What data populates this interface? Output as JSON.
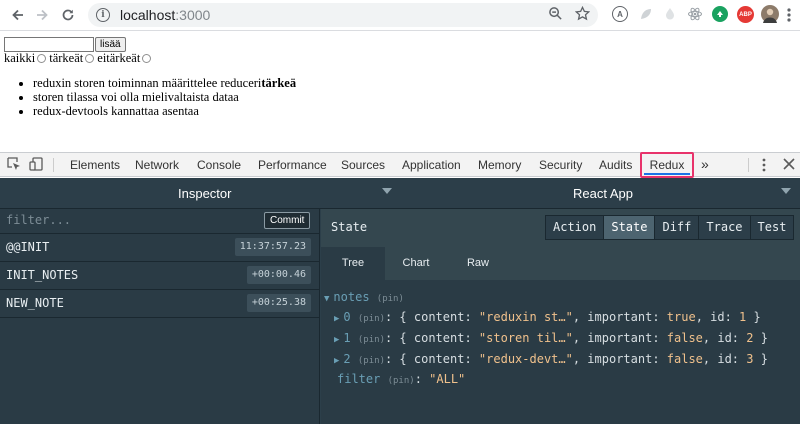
{
  "browser": {
    "url_host": "localhost",
    "url_port": ":3000",
    "extensions": [
      "A",
      "ABP"
    ]
  },
  "page": {
    "add_button": "lisää",
    "filters": [
      "kaikki",
      "tärkeät",
      "eitärkeät"
    ],
    "notes": [
      {
        "text": "reduxin storen toiminnan määrittelee reduceri",
        "bold": "tärkeä"
      },
      {
        "text": "storen tilassa voi olla mielivaltaista dataa",
        "bold": ""
      },
      {
        "text": "redux-devtools kannattaa asentaa",
        "bold": ""
      }
    ]
  },
  "devtools": {
    "tabs": [
      "Elements",
      "Network",
      "Console",
      "Performance",
      "Sources",
      "Application",
      "Memory",
      "Security",
      "Audits",
      "Redux"
    ],
    "more": "»"
  },
  "redux": {
    "left_title": "Inspector",
    "right_title": "React App",
    "filter_placeholder": "filter...",
    "commit_label": "Commit",
    "actions": [
      {
        "name": "@@INIT",
        "time": "11:37:57.23"
      },
      {
        "name": "INIT_NOTES",
        "time": "+00:00.46"
      },
      {
        "name": "NEW_NOTE",
        "time": "+00:25.38"
      }
    ],
    "state_title": "State",
    "modes": [
      "Action",
      "State",
      "Diff",
      "Trace",
      "Test"
    ],
    "subtabs": [
      "Tree",
      "Chart",
      "Raw"
    ],
    "tree": {
      "root_key": "notes",
      "pin": "(pin)",
      "items": [
        {
          "idx": "0",
          "content": "reduxin st…",
          "important": "true",
          "id": "1"
        },
        {
          "idx": "1",
          "content": "storen til…",
          "important": "false",
          "id": "2"
        },
        {
          "idx": "2",
          "content": "redux-devt…",
          "important": "false",
          "id": "3"
        }
      ],
      "filter_key": "filter",
      "filter_value": "\"ALL\""
    }
  },
  "colors": {
    "redux_bg": "#2c3f4a",
    "highlight_border": "#e8336b",
    "string": "#f0c18c",
    "key": "#6a9fb5"
  }
}
